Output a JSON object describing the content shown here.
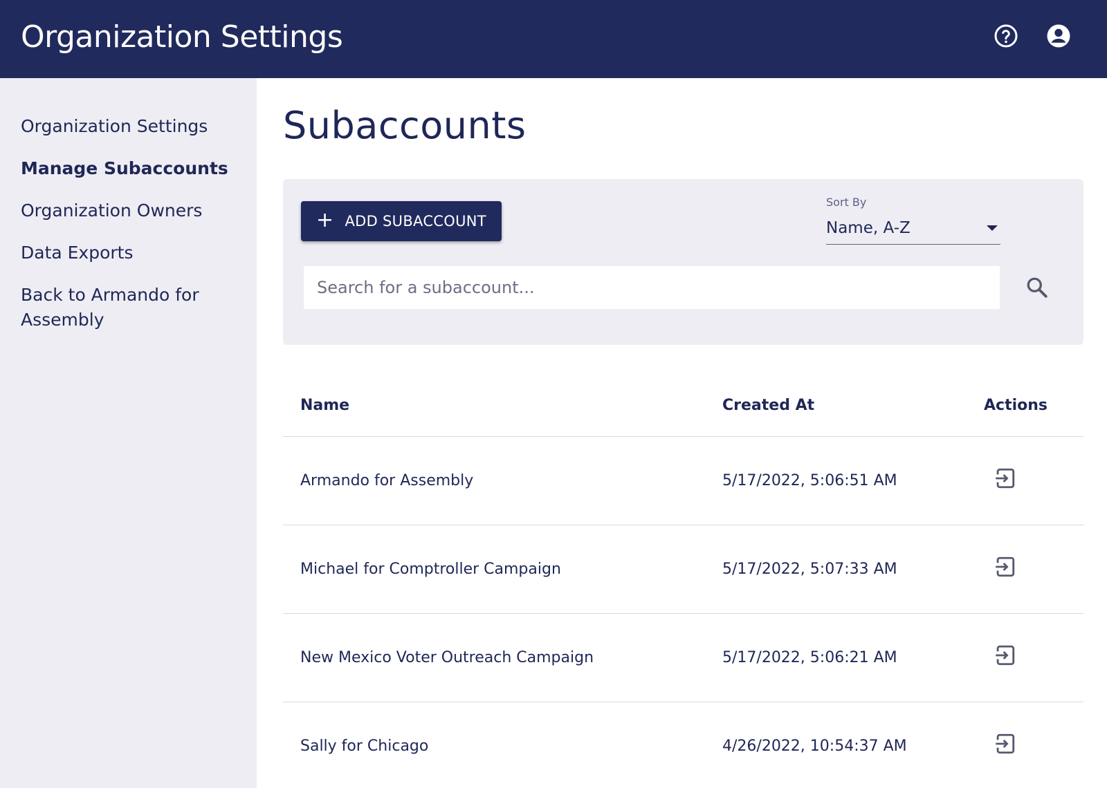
{
  "header": {
    "title": "Organization Settings",
    "help_icon": "help-circle-icon",
    "account_icon": "account-circle-icon",
    "bg_color": "#212a5c"
  },
  "sidebar": {
    "items": [
      {
        "label": "Organization Settings",
        "active": false
      },
      {
        "label": "Manage Subaccounts",
        "active": true
      },
      {
        "label": "Organization Owners",
        "active": false
      },
      {
        "label": "Data Exports",
        "active": false
      },
      {
        "label": "Back to Armando for Assembly",
        "active": false
      }
    ]
  },
  "main": {
    "title": "Subaccounts",
    "add_button": {
      "label": "ADD SUBACCOUNT",
      "icon": "plus-icon"
    },
    "sort": {
      "label": "Sort By",
      "value": "Name, A-Z"
    },
    "search": {
      "placeholder": "Search for a subaccount...",
      "value": "",
      "icon": "search-icon"
    },
    "table": {
      "columns": [
        "Name",
        "Created At",
        "Actions"
      ],
      "rows": [
        {
          "name": "Armando for Assembly",
          "created_at": "5/17/2022, 5:06:51 AM",
          "action_icon": "login-icon"
        },
        {
          "name": "Michael for Comptroller Campaign",
          "created_at": "5/17/2022, 5:07:33 AM",
          "action_icon": "login-icon"
        },
        {
          "name": "New Mexico Voter Outreach Campaign",
          "created_at": "5/17/2022, 5:06:21 AM",
          "action_icon": "login-icon"
        },
        {
          "name": "Sally for Chicago",
          "created_at": "4/26/2022, 10:54:37 AM",
          "action_icon": "login-icon"
        }
      ]
    }
  }
}
